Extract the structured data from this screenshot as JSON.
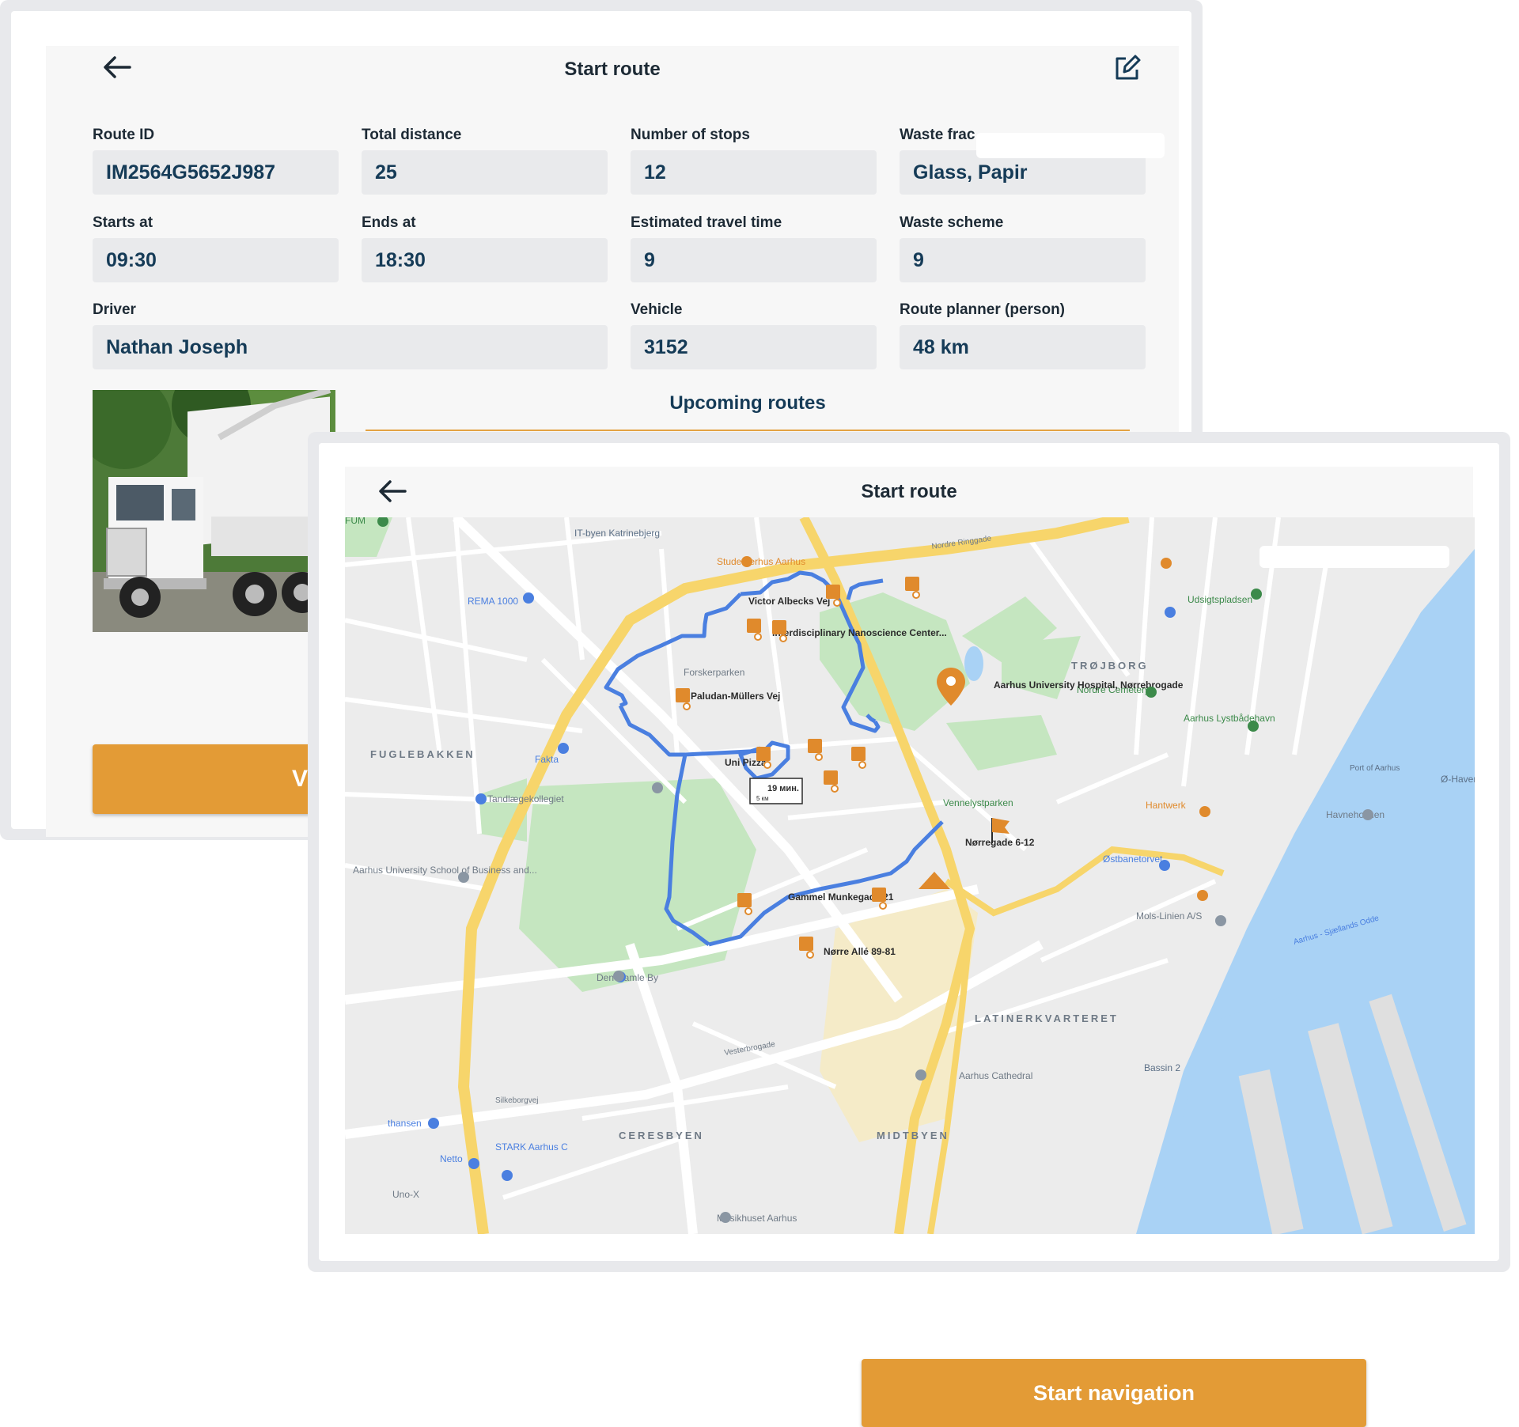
{
  "back_screen": {
    "title": "Start route",
    "fields": [
      {
        "key": "route_id",
        "label": "Route ID",
        "value": "IM2564G5652J987"
      },
      {
        "key": "total_distance",
        "label": "Total distance",
        "value": "25"
      },
      {
        "key": "number_of_stops",
        "label": "Number of stops",
        "value": "12"
      },
      {
        "key": "waste_fraction",
        "label": "Waste frac",
        "value": "Glass, Papir"
      },
      {
        "key": "starts_at",
        "label": "Starts at",
        "value": "09:30"
      },
      {
        "key": "ends_at",
        "label": "Ends at",
        "value": "18:30"
      },
      {
        "key": "estimated_travel_time",
        "label": "Estimated travel time",
        "value": "9"
      },
      {
        "key": "waste_scheme",
        "label": "Waste scheme",
        "value": "9"
      },
      {
        "key": "driver",
        "label": "Driver",
        "value": "Nathan Joseph"
      },
      {
        "key": "vehicle",
        "label": "Vehicle",
        "value": "3152"
      },
      {
        "key": "route_planner",
        "label": "Route planner (person)",
        "value": "48 km"
      }
    ],
    "upcoming_title": "Upcoming routes",
    "view_button_label": "Vie"
  },
  "front_screen": {
    "title": "Start route",
    "start_navigation_label": "Start navigation",
    "map": {
      "districts": [
        "TRØJBORG",
        "FUGLEBAKKEN",
        "LATINERKVARTERET",
        "CERESBYEN",
        "MIDTBYEN"
      ],
      "stops": [
        "Victor Albecks Vej",
        "Interdisciplinary Nanoscience Center...",
        "Paludan-Müllers Vej",
        "Uni Pizza",
        "Gammel Munkegade 21",
        "Nørre Allé 89-81",
        "Nørregade 6-12",
        "Aarhus University Hospital, Nørrebrogade"
      ],
      "eta_box": {
        "time": "19 мин.",
        "distance": "5 км"
      },
      "pois": [
        "IT-byen Katrinebjerg",
        "Studenterhus Aarhus",
        "REMA 1000",
        "Forskerparken",
        "Fakta",
        "Tandlægekollegiet",
        "Aarhus University School of Business and...",
        "Den Gamle By",
        "thansen",
        "Netto",
        "STARK Aarhus C",
        "Uno-X",
        "Musikhuset Aarhus",
        "Aarhus Cathedral",
        "Vennelystparken",
        "Nordre Cemetery",
        "Aarhus Lystbådehavn",
        "Udsigtspladsen",
        "Hantwerk",
        "Østbanetorvet",
        "Mols-Linien A/S",
        "Havneholmen",
        "Bassin 2",
        "Ø-Haven",
        "Port of Aarhus",
        "FUM"
      ],
      "streets": [
        "Nordre Ringgade",
        "Vesterbrogade",
        "Silkeborgvej",
        "Aarhus - Sjællands Odde"
      ],
      "route_color": "#4a7fe0",
      "marker_color": "#e08a2c"
    }
  },
  "colors": {
    "accent": "#e39b36",
    "text_dark": "#153b57",
    "field_bg": "#e9eaec",
    "water": "#a9d2f5",
    "park": "#c5e6c0"
  }
}
